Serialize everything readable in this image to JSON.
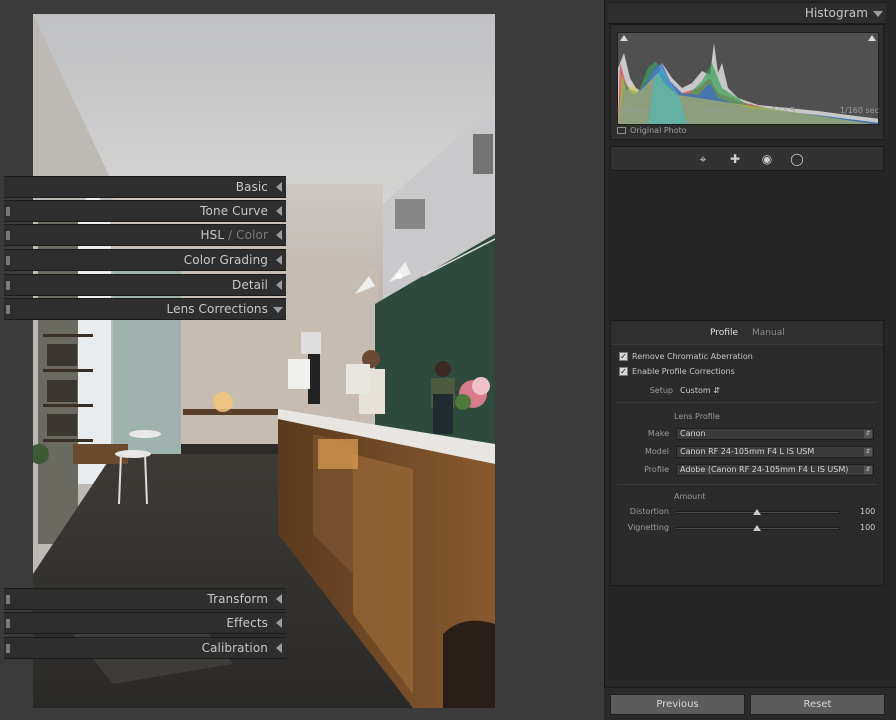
{
  "histogram": {
    "title": "Histogram",
    "iso": "ISO 800",
    "focal": "26 mm",
    "aperture": "ƒ / 4,5",
    "shutter": "1/160 sec",
    "original_photo": "Original Photo"
  },
  "tools": [
    "crop-icon",
    "heal-icon",
    "redeye-icon",
    "mask-icon"
  ],
  "panels": {
    "basic": "Basic",
    "tone_curve": "Tone Curve",
    "hsl": "HSL",
    "hsl_sep": " / ",
    "color": "Color",
    "color_grading": "Color Grading",
    "detail": "Detail",
    "lens_corrections": "Lens Corrections",
    "transform": "Transform",
    "effects": "Effects",
    "calibration": "Calibration"
  },
  "lens": {
    "tab_profile": "Profile",
    "tab_manual": "Manual",
    "remove_ca": "Remove Chromatic Aberration",
    "enable_profile": "Enable Profile Corrections",
    "setup_label": "Setup",
    "setup_value": "Custom",
    "lens_profile_heading": "Lens Profile",
    "make_label": "Make",
    "make_value": "Canon",
    "model_label": "Model",
    "model_value": "Canon RF 24-105mm F4 L IS USM",
    "profile_label": "Profile",
    "profile_value": "Adobe (Canon RF 24-105mm F4 L IS USM)",
    "amount_heading": "Amount",
    "distortion_label": "Distortion",
    "distortion_value": "100",
    "vignetting_label": "Vignetting",
    "vignetting_value": "100"
  },
  "buttons": {
    "previous": "Previous",
    "reset": "Reset"
  }
}
